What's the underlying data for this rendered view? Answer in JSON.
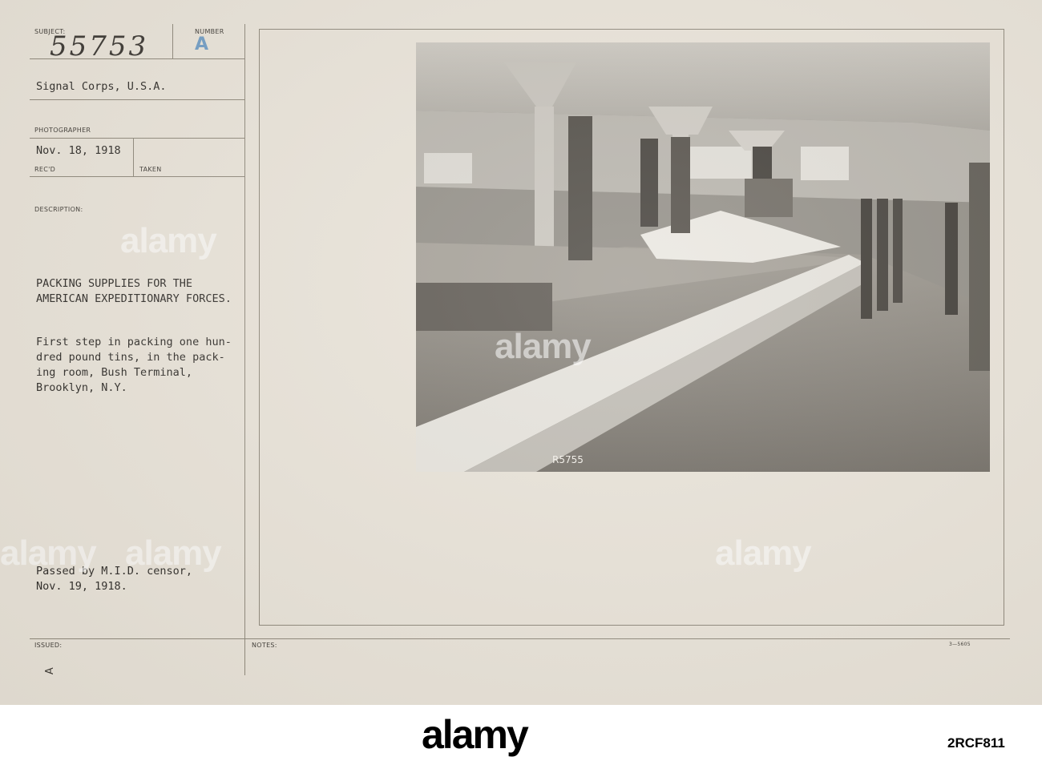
{
  "card": {
    "subject_label": "SUBJECT:",
    "number_label": "NUMBER",
    "subject_number": "55753",
    "number_value": "A",
    "unit": "Signal Corps, U.S.A.",
    "photographer_label": "PHOTOGRAPHER",
    "received_date": "Nov. 18, 1918",
    "recd_label": "REC'D",
    "taken_label": "TAKEN",
    "description_label": "DESCRIPTION:",
    "title_line1": "PACKING SUPPLIES FOR THE",
    "title_line2": "AMERICAN EXPEDITIONARY FORCES.",
    "desc_line1": "First step in packing one hun-",
    "desc_line2": "dred pound tins, in the pack-",
    "desc_line3": "ing room, Bush Terminal,",
    "desc_line4": "Brooklyn, N.Y.",
    "censor_line1": "Passed by M.I.D. censor,",
    "censor_line2": "Nov. 19, 1918.",
    "issued_label": "ISSUED:",
    "issued_mark": "A",
    "notes_label": "NOTES:",
    "form_number": "3—5605",
    "negative_number": "R5755"
  },
  "watermark": {
    "text": "alamy"
  },
  "footer": {
    "logo": "alamy",
    "image_code": "2RCF811"
  }
}
